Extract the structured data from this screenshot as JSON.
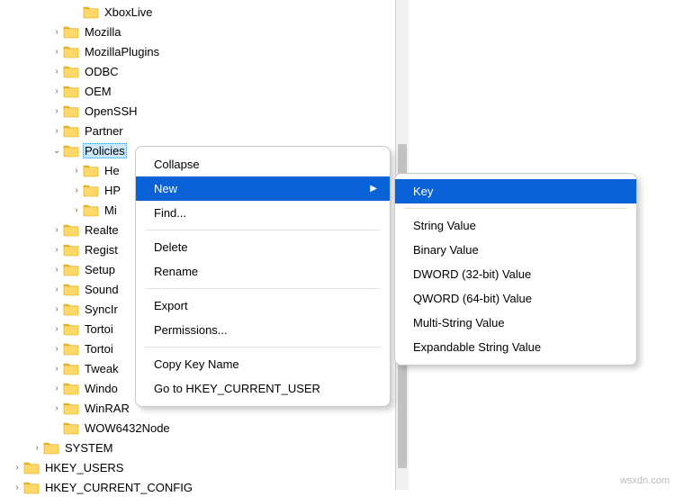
{
  "tree": {
    "items": [
      {
        "indent": 4,
        "caret": "none",
        "label": "XboxLive"
      },
      {
        "indent": 3,
        "caret": "closed",
        "label": "Mozilla"
      },
      {
        "indent": 3,
        "caret": "closed",
        "label": "MozillaPlugins"
      },
      {
        "indent": 3,
        "caret": "closed",
        "label": "ODBC"
      },
      {
        "indent": 3,
        "caret": "closed",
        "label": "OEM"
      },
      {
        "indent": 3,
        "caret": "closed",
        "label": "OpenSSH"
      },
      {
        "indent": 3,
        "caret": "closed",
        "label": "Partner"
      },
      {
        "indent": 3,
        "caret": "open",
        "label": "Policies",
        "selected": true
      },
      {
        "indent": 4,
        "caret": "closed",
        "label": "He"
      },
      {
        "indent": 4,
        "caret": "closed",
        "label": "HP"
      },
      {
        "indent": 4,
        "caret": "closed",
        "label": "Mi"
      },
      {
        "indent": 3,
        "caret": "closed",
        "label": "Realte"
      },
      {
        "indent": 3,
        "caret": "closed",
        "label": "Regist"
      },
      {
        "indent": 3,
        "caret": "closed",
        "label": "Setup"
      },
      {
        "indent": 3,
        "caret": "closed",
        "label": "Sound"
      },
      {
        "indent": 3,
        "caret": "closed",
        "label": "SyncIr"
      },
      {
        "indent": 3,
        "caret": "closed",
        "label": "Tortoi"
      },
      {
        "indent": 3,
        "caret": "closed",
        "label": "Tortoi"
      },
      {
        "indent": 3,
        "caret": "closed",
        "label": "Tweak"
      },
      {
        "indent": 3,
        "caret": "closed",
        "label": "Windo"
      },
      {
        "indent": 3,
        "caret": "closed",
        "label": "WinRAR"
      },
      {
        "indent": 3,
        "caret": "none",
        "label": "WOW6432Node"
      },
      {
        "indent": 2,
        "caret": "closed",
        "label": "SYSTEM"
      },
      {
        "indent": 1,
        "caret": "closed",
        "label": "HKEY_USERS"
      },
      {
        "indent": 1,
        "caret": "closed",
        "label": "HKEY_CURRENT_CONFIG"
      }
    ]
  },
  "context_menu": {
    "collapse": "Collapse",
    "new": "New",
    "find": "Find...",
    "delete": "Delete",
    "rename": "Rename",
    "export": "Export",
    "permissions": "Permissions...",
    "copy_key_name": "Copy Key Name",
    "goto": "Go to HKEY_CURRENT_USER"
  },
  "new_submenu": {
    "key": "Key",
    "string": "String Value",
    "binary": "Binary Value",
    "dword": "DWORD (32-bit) Value",
    "qword": "QWORD (64-bit) Value",
    "multistring": "Multi-String Value",
    "expandable": "Expandable String Value"
  },
  "watermark": "wsxdn.com"
}
